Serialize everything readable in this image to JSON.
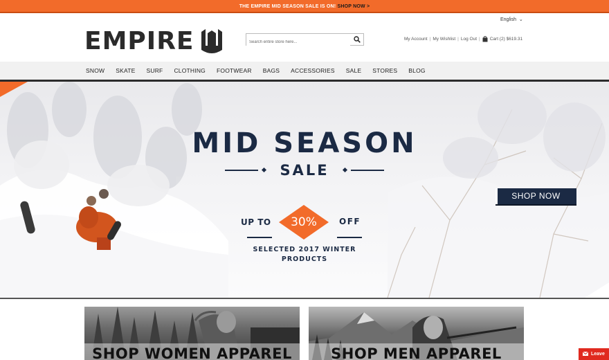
{
  "promo": {
    "text": "THE EMPIRE MID SEASON SALE IS ON!",
    "link": "SHOP NOW >"
  },
  "language": "English",
  "logo": {
    "text": "EMPIRE"
  },
  "search": {
    "placeholder": "Search entire store here..."
  },
  "account": {
    "my_account": "My Account",
    "my_wishlist": "My Wishlist",
    "log_out": "Log Out",
    "cart": "Cart (2)",
    "cart_total": "$619.31"
  },
  "nav": {
    "items": [
      "SNOW",
      "SKATE",
      "SURF",
      "CLOTHING",
      "FOOTWEAR",
      "BAGS",
      "ACCESSORIES",
      "SALE",
      "STORES",
      "BLOG"
    ]
  },
  "hero": {
    "title": "MID SEASON",
    "subtitle": "SALE",
    "shop_now": "SHOP NOW",
    "up_to": "UP TO",
    "discount": "30%",
    "off": "OFF",
    "note_line1": "SELECTED 2017 WINTER",
    "note_line2": "PRODUCTS"
  },
  "tiles": {
    "women": "SHOP WOMEN APPAREL",
    "men": "SHOP MEN APPAREL"
  },
  "chat": {
    "label": "Leave"
  },
  "colors": {
    "accent": "#f26b2a",
    "navy": "#1b2a44",
    "chat_red": "#e02a1f"
  }
}
